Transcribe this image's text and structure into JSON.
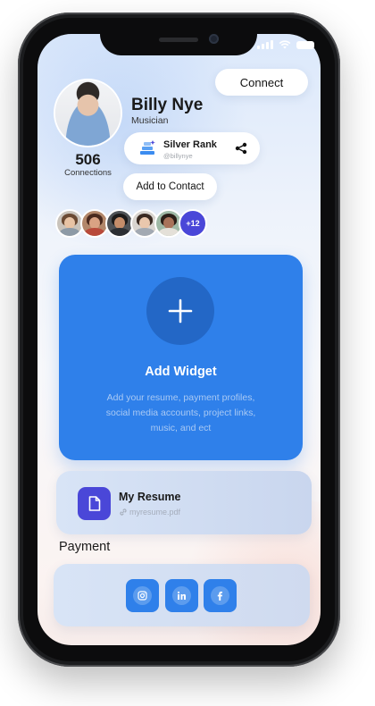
{
  "header": {
    "connect_label": "Connect"
  },
  "profile": {
    "name": "Billy Nye",
    "role": "Musician",
    "connections_count": "506",
    "connections_label": "Connections",
    "rank_title": "Silver Rank",
    "rank_handle": "@billynye",
    "add_contact_label": "Add to Contact",
    "more_connections": "+12"
  },
  "widget": {
    "title": "Add Widget",
    "description": "Add your resume, payment profiles, social media accounts, project links, music, and ect"
  },
  "resume": {
    "title": "My Resume",
    "file": "myresume.pdf"
  },
  "payment": {
    "title": "Payment",
    "socials": [
      "instagram-icon",
      "linkedin-icon",
      "facebook-icon"
    ]
  },
  "colors": {
    "accent": "#2f80ea",
    "accent_dark": "#2367c6",
    "purple": "#4a47d8"
  }
}
